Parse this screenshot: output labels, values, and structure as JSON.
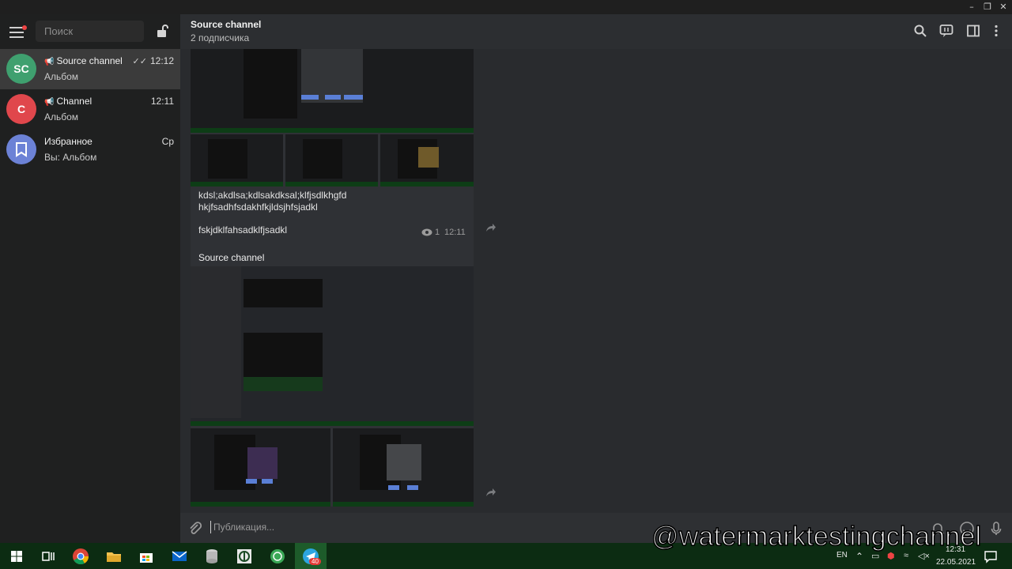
{
  "window": {
    "minimize": "–",
    "restore": "❐",
    "close": "✕"
  },
  "sidebar": {
    "search_placeholder": "Поиск",
    "chats": [
      {
        "initials": "SC",
        "name": "Source channel",
        "time": "12:12",
        "subtitle": "Альбом",
        "color": "#3fa06f",
        "active": true
      },
      {
        "initials": "C",
        "name": "Channel",
        "time": "12:11",
        "subtitle": "Альбом",
        "color": "#e0474c",
        "active": false
      },
      {
        "initials": "",
        "name": "Избранное",
        "time": "Ср",
        "subtitle": "Вы: Альбом",
        "color": "#6c82d6",
        "active": false
      }
    ]
  },
  "header": {
    "title": "Source channel",
    "subtitle": "2 подписчика"
  },
  "messages": {
    "text_line1": "kdsl;akdlsa;kdlsakdksal;klfjsdlkhgfd",
    "text_line2": "hkjfsadhfsdakhfkjldsjhfsjadkl",
    "text_line3": "fskjdklfahsadklfjsadkl",
    "views": "1",
    "time": "12:11",
    "author": "Source channel"
  },
  "composer": {
    "placeholder": "Публикация..."
  },
  "watermark": "@watermarktestingchannel",
  "taskbar": {
    "lang": "EN",
    "time": "12:31",
    "date": "22.05.2021",
    "badge": "40"
  }
}
